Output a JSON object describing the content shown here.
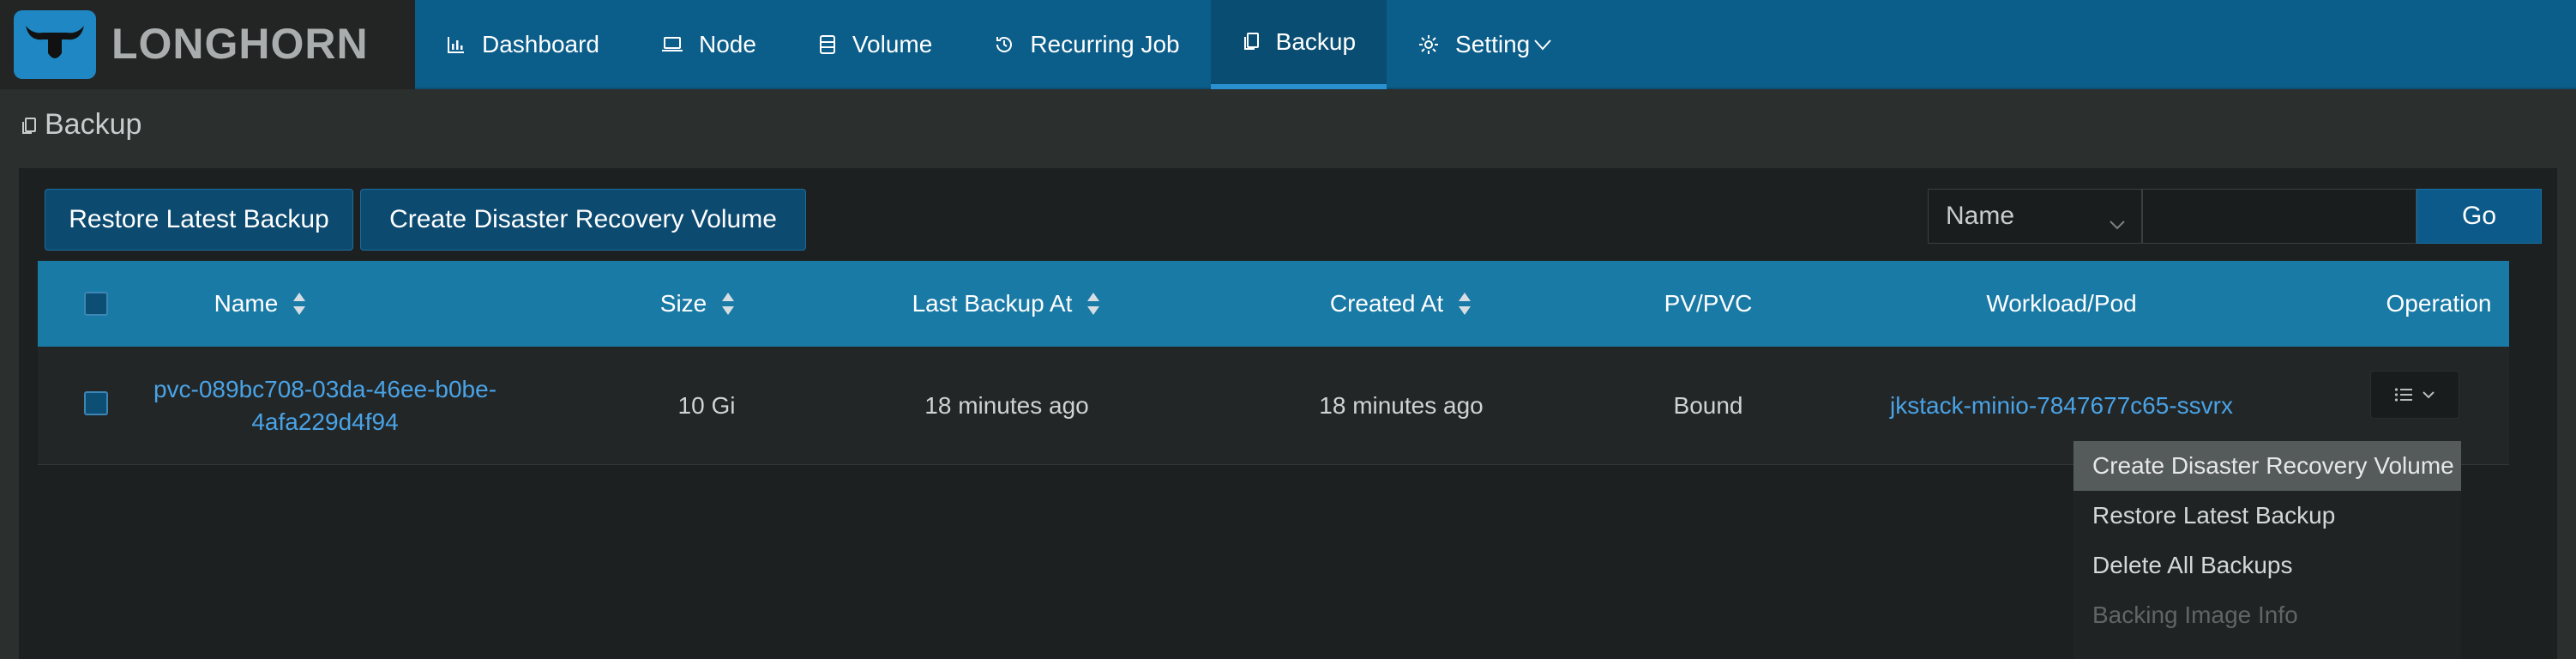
{
  "app": {
    "brand": "LONGHORN"
  },
  "nav": {
    "items": [
      {
        "label": "Dashboard",
        "icon": "bar-chart-icon"
      },
      {
        "label": "Node",
        "icon": "laptop-icon"
      },
      {
        "label": "Volume",
        "icon": "database-icon"
      },
      {
        "label": "Recurring Job",
        "icon": "clock-history-icon"
      },
      {
        "label": "Backup",
        "icon": "copy-icon",
        "active": true
      },
      {
        "label": "Setting",
        "icon": "gear-icon"
      }
    ]
  },
  "page": {
    "title": "Backup"
  },
  "toolbar": {
    "restore_label": "Restore Latest Backup",
    "dr_label": "Create Disaster Recovery Volume",
    "search_field": "Name",
    "search_value": "",
    "go_label": "Go"
  },
  "table": {
    "columns": [
      "Name",
      "Size",
      "Last Backup At",
      "Created At",
      "PV/PVC",
      "Workload/Pod",
      "Operation"
    ],
    "rows": [
      {
        "name_line1": "pvc-089bc708-03da-46ee-b0be-",
        "name_line2": "4afa229d4f94",
        "size": "10 Gi",
        "last_backup_at": "18 minutes ago",
        "created_at": "18 minutes ago",
        "pv_pvc": "Bound",
        "workload_pod": "jkstack-minio-7847677c65-ssvrx"
      }
    ]
  },
  "menu": {
    "items": [
      {
        "label": "Create Disaster Recovery Volume",
        "state": "highlighted"
      },
      {
        "label": "Restore Latest Backup",
        "state": "normal"
      },
      {
        "label": "Delete All Backups",
        "state": "normal"
      },
      {
        "label": "Backing Image Info",
        "state": "disabled"
      }
    ]
  },
  "colors": {
    "nav_bg": "#0b5d8a",
    "table_header": "#1a7aa6",
    "link": "#4aa3e6",
    "page_bg": "#2b2f2e"
  }
}
